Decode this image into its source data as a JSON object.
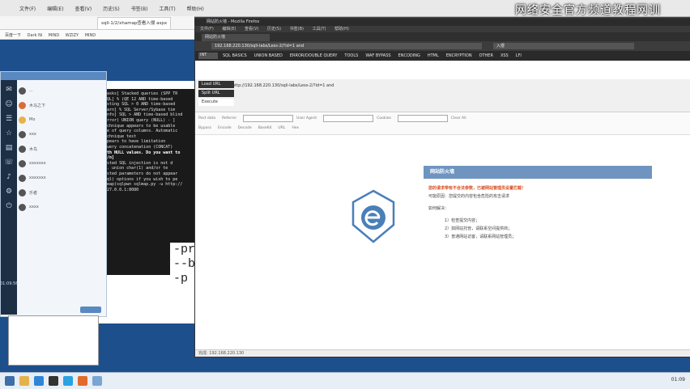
{
  "watermark": "网络安全官方频道教程网训",
  "background_browser": {
    "menu": [
      "文件(F)",
      "编辑(E)",
      "查看(V)",
      "历史(S)",
      "书签(B)",
      "工具(T)",
      "帮助(H)"
    ],
    "tab_label": "sqli-1/2/xhamap查看入侵 aspx",
    "bookmarks": [
      "百度一下",
      "Dark Ni",
      "MIND",
      "WZIZY",
      "MIND"
    ]
  },
  "chat": {
    "items": [
      {
        "name": "...",
        "text": "...."
      },
      {
        "name": "木马之下",
        "text": "xxx"
      },
      {
        "name": "Mo",
        "text": ""
      },
      {
        "name": "xxx",
        "text": ""
      },
      {
        "name": "木鸟",
        "text": ""
      },
      {
        "name": "xxxxxxx",
        "text": ""
      },
      {
        "name": "xxxxxxx",
        "text": ""
      },
      {
        "name": "乐者",
        "text": ""
      },
      {
        "name": "xxxx",
        "text": ""
      }
    ],
    "time": "01:09:56",
    "send_label": ""
  },
  "terminal": {
    "lines": [
      "[tasks] Stacked queries (SPP TR",
      "[SQL] % (QE 12 AND time-based",
      "testing SQL > 0 AND time-based",
      "[warn] % SQL Server/Sybase tim",
      "[info] SQL > AND time-based blind",
      "(error) UNION query (NULL) - ]",
      "technique appears to be usable",
      "use of query columns. Automatic",
      "technique test",
      "appears to have limitation ",
      "(query concatenation (CONCAT)",
      "with NULL values. Do you want to",
      "[Y/n]",
      "tested SQL injection is not d",
      "... union char(1) and/or te",
      "",
      "tested parameters do not appear",
      "(Sql) options if you wish to pe",
      "",
      "(leap)sqlpwn sqlmap.py -u http://",
      "-127.0.0.1:8080"
    ],
    "big_cmd": [
      "-pro",
      "--ba",
      "-p"
    ]
  },
  "firefox": {
    "title": "网站防火墙 - Mozilla Firefox",
    "menu": [
      "文件(F)",
      "编辑(E)",
      "查看(V)",
      "历史(S)",
      "书签(B)",
      "工具(T)",
      "帮助(H)"
    ],
    "tab": "网站防火墙",
    "url": "192.168.220.130/sqli-labs/Less-2/?id=1 and",
    "search": "入侵",
    "hackbar": {
      "select": "INT",
      "items": [
        "SQL BASICS",
        "UNION BASED",
        "ERROR/DOUBLE QUERY",
        "TOOLS",
        "WAF BYPASS",
        "ENCODING",
        "HTML",
        "ENCRYPTION",
        "OTHER",
        "XSS",
        "LFI"
      ],
      "load_url": "Load URL",
      "split_url": "Split URL",
      "execute": "Execute",
      "url_value": "http://192.168.220.130/sqli-labs/Less-2/?id=1 and"
    },
    "toolbar_row1": [
      "Post data",
      "Referrer",
      "User Agent",
      "Cookies",
      "Clear All"
    ],
    "toolbar_row2": [
      "Bypass",
      "Encode",
      "Decode",
      "Base64",
      "URL",
      "Hex"
    ],
    "status": "完成: 192.168.220.130"
  },
  "error_page": {
    "header": "网站防火墙",
    "red_line": "您的请求带有不合法参数，已被网站管理员设置拦截！",
    "line1": "可能原因：您提交的内容包含危险的攻击请求",
    "line2": "如何解决：",
    "steps": [
      "1）检查提交内容；",
      "2）如网站托管，请联系空间提供商；",
      "3）普通网站访客，请联系网站管理员；"
    ]
  },
  "taskbar": {
    "tray": "01:09"
  },
  "colors": {
    "desktop": "#1d4f8c",
    "error_header": "#6f94c0",
    "error_red": "#d94b1e",
    "terminal_bg": "#1a1a1a"
  }
}
